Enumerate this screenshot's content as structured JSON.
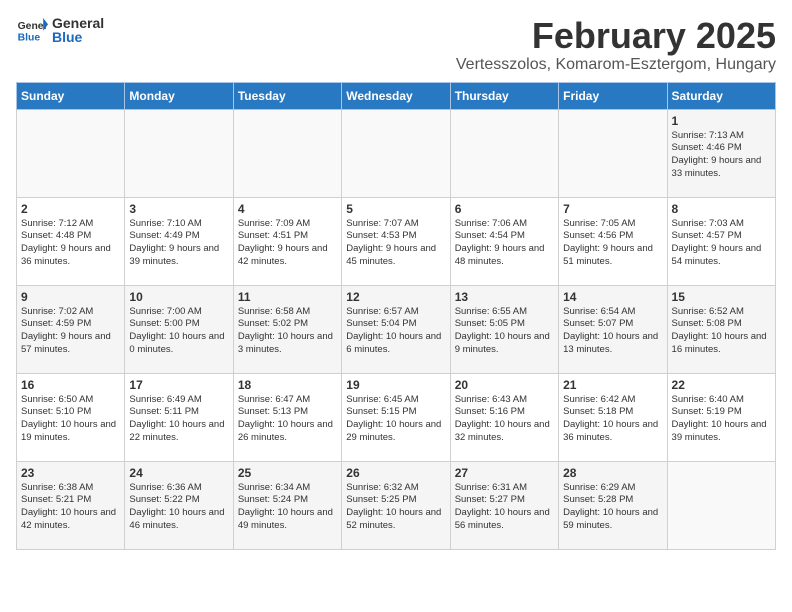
{
  "logo": {
    "general": "General",
    "blue": "Blue"
  },
  "header": {
    "title": "February 2025",
    "subtitle": "Vertesszolos, Komarom-Esztergom, Hungary"
  },
  "weekdays": [
    "Sunday",
    "Monday",
    "Tuesday",
    "Wednesday",
    "Thursday",
    "Friday",
    "Saturday"
  ],
  "weeks": [
    [
      {
        "day": "",
        "info": ""
      },
      {
        "day": "",
        "info": ""
      },
      {
        "day": "",
        "info": ""
      },
      {
        "day": "",
        "info": ""
      },
      {
        "day": "",
        "info": ""
      },
      {
        "day": "",
        "info": ""
      },
      {
        "day": "1",
        "info": "Sunrise: 7:13 AM\nSunset: 4:46 PM\nDaylight: 9 hours and 33 minutes."
      }
    ],
    [
      {
        "day": "2",
        "info": "Sunrise: 7:12 AM\nSunset: 4:48 PM\nDaylight: 9 hours and 36 minutes."
      },
      {
        "day": "3",
        "info": "Sunrise: 7:10 AM\nSunset: 4:49 PM\nDaylight: 9 hours and 39 minutes."
      },
      {
        "day": "4",
        "info": "Sunrise: 7:09 AM\nSunset: 4:51 PM\nDaylight: 9 hours and 42 minutes."
      },
      {
        "day": "5",
        "info": "Sunrise: 7:07 AM\nSunset: 4:53 PM\nDaylight: 9 hours and 45 minutes."
      },
      {
        "day": "6",
        "info": "Sunrise: 7:06 AM\nSunset: 4:54 PM\nDaylight: 9 hours and 48 minutes."
      },
      {
        "day": "7",
        "info": "Sunrise: 7:05 AM\nSunset: 4:56 PM\nDaylight: 9 hours and 51 minutes."
      },
      {
        "day": "8",
        "info": "Sunrise: 7:03 AM\nSunset: 4:57 PM\nDaylight: 9 hours and 54 minutes."
      }
    ],
    [
      {
        "day": "9",
        "info": "Sunrise: 7:02 AM\nSunset: 4:59 PM\nDaylight: 9 hours and 57 minutes."
      },
      {
        "day": "10",
        "info": "Sunrise: 7:00 AM\nSunset: 5:00 PM\nDaylight: 10 hours and 0 minutes."
      },
      {
        "day": "11",
        "info": "Sunrise: 6:58 AM\nSunset: 5:02 PM\nDaylight: 10 hours and 3 minutes."
      },
      {
        "day": "12",
        "info": "Sunrise: 6:57 AM\nSunset: 5:04 PM\nDaylight: 10 hours and 6 minutes."
      },
      {
        "day": "13",
        "info": "Sunrise: 6:55 AM\nSunset: 5:05 PM\nDaylight: 10 hours and 9 minutes."
      },
      {
        "day": "14",
        "info": "Sunrise: 6:54 AM\nSunset: 5:07 PM\nDaylight: 10 hours and 13 minutes."
      },
      {
        "day": "15",
        "info": "Sunrise: 6:52 AM\nSunset: 5:08 PM\nDaylight: 10 hours and 16 minutes."
      }
    ],
    [
      {
        "day": "16",
        "info": "Sunrise: 6:50 AM\nSunset: 5:10 PM\nDaylight: 10 hours and 19 minutes."
      },
      {
        "day": "17",
        "info": "Sunrise: 6:49 AM\nSunset: 5:11 PM\nDaylight: 10 hours and 22 minutes."
      },
      {
        "day": "18",
        "info": "Sunrise: 6:47 AM\nSunset: 5:13 PM\nDaylight: 10 hours and 26 minutes."
      },
      {
        "day": "19",
        "info": "Sunrise: 6:45 AM\nSunset: 5:15 PM\nDaylight: 10 hours and 29 minutes."
      },
      {
        "day": "20",
        "info": "Sunrise: 6:43 AM\nSunset: 5:16 PM\nDaylight: 10 hours and 32 minutes."
      },
      {
        "day": "21",
        "info": "Sunrise: 6:42 AM\nSunset: 5:18 PM\nDaylight: 10 hours and 36 minutes."
      },
      {
        "day": "22",
        "info": "Sunrise: 6:40 AM\nSunset: 5:19 PM\nDaylight: 10 hours and 39 minutes."
      }
    ],
    [
      {
        "day": "23",
        "info": "Sunrise: 6:38 AM\nSunset: 5:21 PM\nDaylight: 10 hours and 42 minutes."
      },
      {
        "day": "24",
        "info": "Sunrise: 6:36 AM\nSunset: 5:22 PM\nDaylight: 10 hours and 46 minutes."
      },
      {
        "day": "25",
        "info": "Sunrise: 6:34 AM\nSunset: 5:24 PM\nDaylight: 10 hours and 49 minutes."
      },
      {
        "day": "26",
        "info": "Sunrise: 6:32 AM\nSunset: 5:25 PM\nDaylight: 10 hours and 52 minutes."
      },
      {
        "day": "27",
        "info": "Sunrise: 6:31 AM\nSunset: 5:27 PM\nDaylight: 10 hours and 56 minutes."
      },
      {
        "day": "28",
        "info": "Sunrise: 6:29 AM\nSunset: 5:28 PM\nDaylight: 10 hours and 59 minutes."
      },
      {
        "day": "",
        "info": ""
      }
    ]
  ]
}
